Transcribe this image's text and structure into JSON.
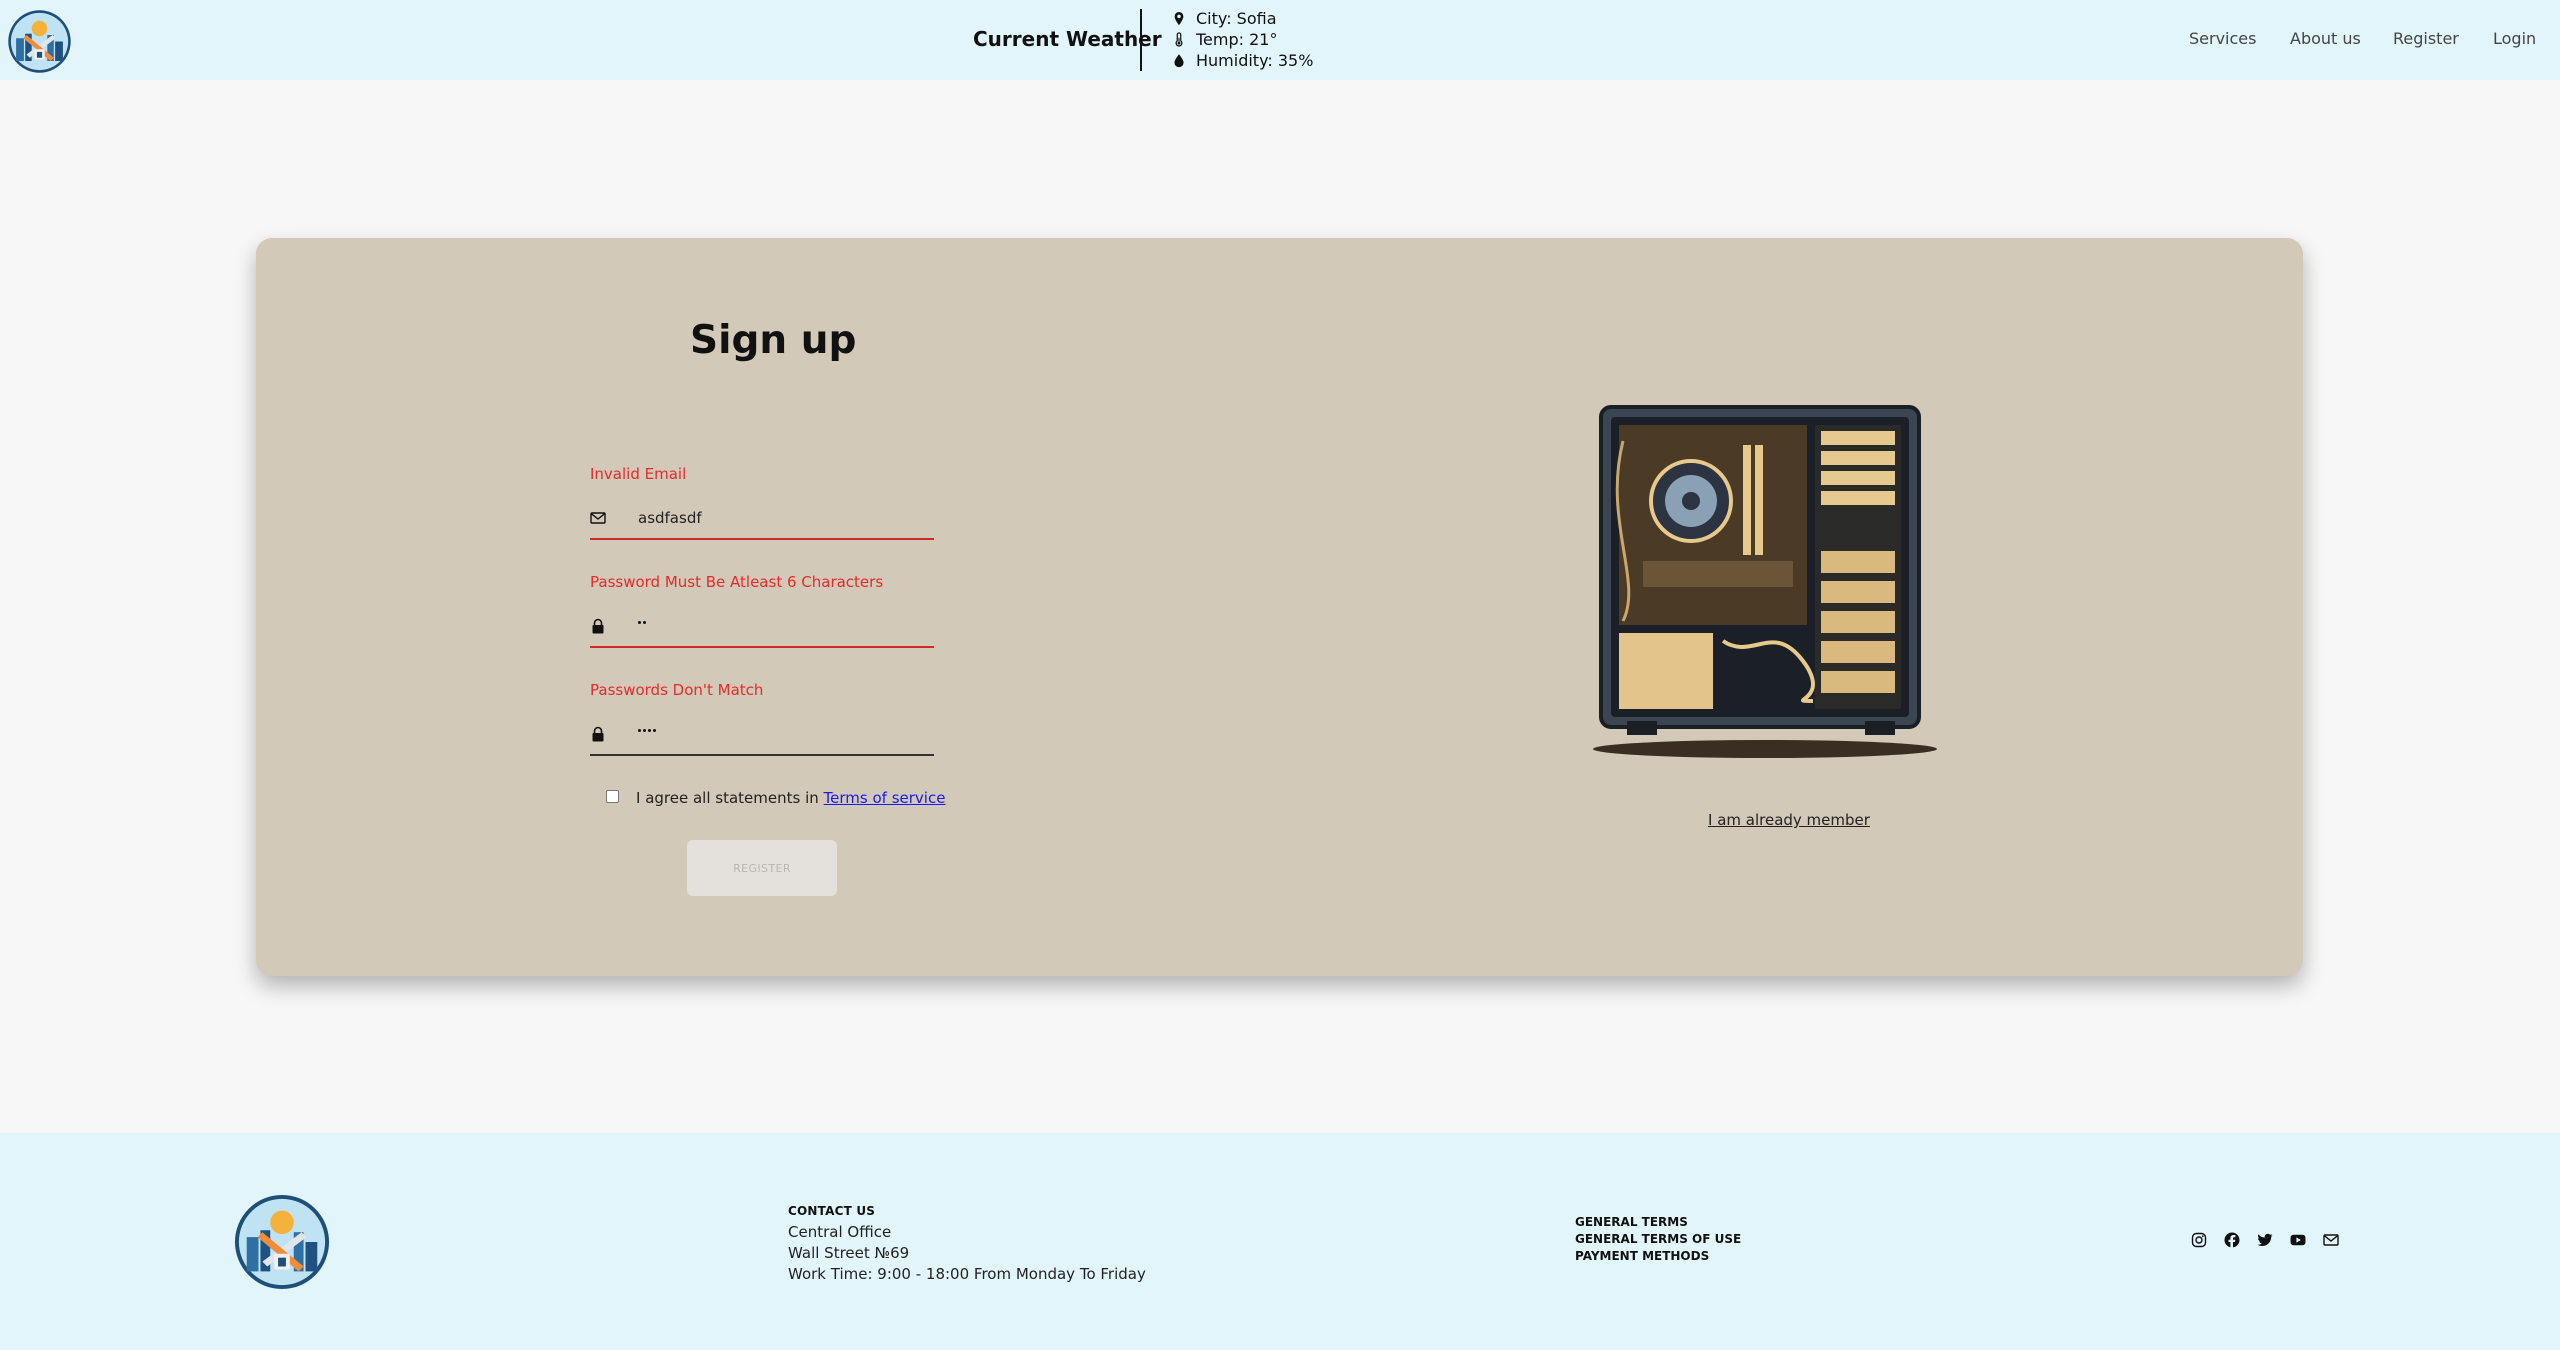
{
  "header": {
    "weather_title": "Current Weather",
    "city": "City: Sofia",
    "temp": "Temp: 21°",
    "humidity": "Humidity: 35%",
    "nav": [
      "Services",
      "About us",
      "Register",
      "Login"
    ]
  },
  "form": {
    "title": "Sign up",
    "email_error": "Invalid Email",
    "email_value": "asdfasdf",
    "password_error": "Password Must Be Atleast 6 Characters",
    "password_length": 2,
    "confirm_error": "Passwords Don't Match",
    "confirm_length": 4,
    "agree_text": "I agree all statements in",
    "terms_link": "Terms of service",
    "agree_checked": false,
    "register_label": "REGISTER",
    "member_link": "I am already member",
    "error_color": "#e52b2b"
  },
  "footer": {
    "contact_heading": "CONTACT US",
    "office": "Central Office",
    "street": "Wall Street №69",
    "hours": "Work Time: 9:00 - 18:00 From Monday To Friday",
    "terms": [
      "GENERAL TERMS",
      "GENERAL TERMS OF USE",
      "PAYMENT METHODS"
    ],
    "socials": [
      "instagram-icon",
      "facebook-icon",
      "twitter-icon",
      "youtube-icon",
      "mail-icon"
    ]
  },
  "colors": {
    "header_bg": "#e2f5fa",
    "card_bg": "#d2c9b8",
    "page_bg": "#f7f7f7"
  }
}
